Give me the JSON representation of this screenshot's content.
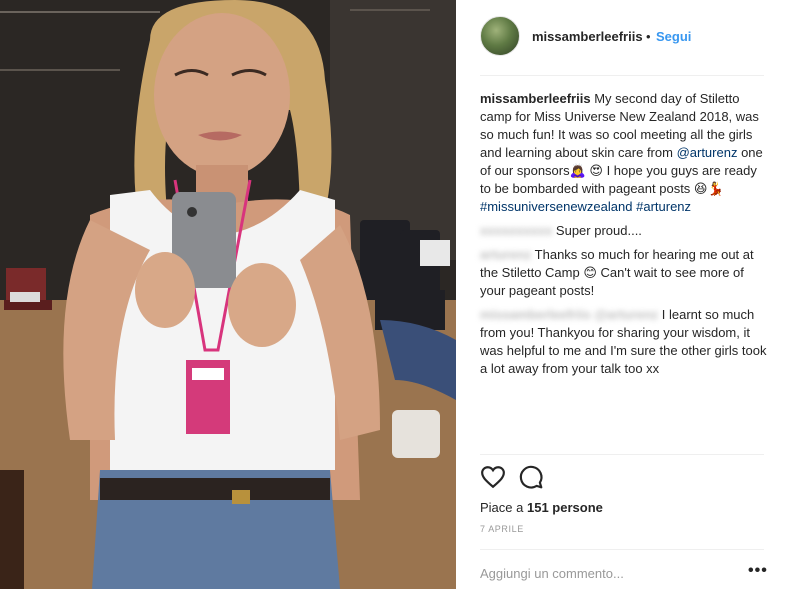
{
  "post": {
    "image_alt": "mirror selfie",
    "author": {
      "username": "missamberleefriis",
      "separator": "•",
      "follow_label": "Segui"
    },
    "caption": {
      "username": "missamberleefriis",
      "text_1": " My second day of Stiletto camp for Miss Universe New Zealand 2018, was so much fun! It was so cool meeting all the girls and learning about skin care from ",
      "mention_1": "@arturenz",
      "text_2": " one of our sponsors🙇‍♀️ 😍 I hope you guys are ready to be bombarded with pageant posts 😆💃 ",
      "hashtag_1": "#missuniversenewzealand",
      "text_3": " ",
      "hashtag_2": "#arturenz"
    },
    "comments": [
      {
        "username": "xxxxxxxxxx",
        "text": " Super proud...."
      },
      {
        "username": "arturenz",
        "text": " Thanks so much for hearing me out at the Stiletto Camp 😊 Can't wait to see more of your pageant posts!"
      },
      {
        "username": "missamberleefriis",
        "mention": "@arturenz",
        "text": " I learnt so much from you! Thankyou for sharing your wisdom, it was helpful to me and I'm sure the other girls took a lot away from your talk too xx"
      }
    ],
    "actions": {
      "like_icon": "heart-icon",
      "comment_icon": "comment-icon"
    },
    "likes_prefix": "Piace a ",
    "likes_count": "151",
    "likes_suffix": " persone",
    "date": "7 APRILE",
    "comment_placeholder": "Aggiungi un commento...",
    "more_label": "•••"
  },
  "colors": {
    "link": "#003569",
    "follow": "#3897f0",
    "text": "#262626",
    "muted": "#999999"
  }
}
